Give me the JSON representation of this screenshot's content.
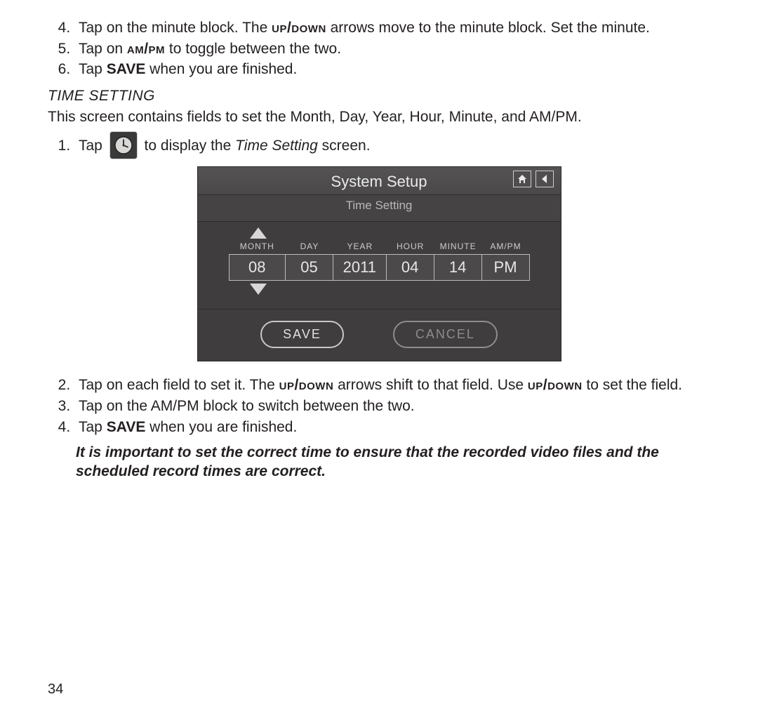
{
  "steps_a": {
    "s4a": "Tap on the minute block. The ",
    "s4b": " arrows move to the minute block. Set the minute.",
    "s5a": "Tap on ",
    "s5b": " to toggle between the two.",
    "s6a": "Tap ",
    "s6b": " when you are finished.",
    "updown": "up/down",
    "ampm": "am/pm",
    "save": "SAVE"
  },
  "section": "TIME SETTING",
  "section_para": "This screen contains fields to set the Month, Day, Year, Hour, Minute, and AM/PM.",
  "steps_b": {
    "s1a": "Tap ",
    "s1b": " to display the ",
    "s1c": " screen.",
    "time_setting_ital": "Time Setting",
    "s2a": "Tap on each field to set it. The ",
    "s2b": " arrows shift to that field. Use ",
    "s2c": " to set the field.",
    "s3": "Tap on the AM/PM block to switch between the two.",
    "s4a": "Tap ",
    "s4b": " when you are finished.",
    "updown": "up/down",
    "save": "SAVE"
  },
  "note": "It is important to set the correct time to ensure that the recorded video files and the scheduled record times are correct.",
  "shot": {
    "title": "System Setup",
    "subtitle": "Time Setting",
    "labels": {
      "month": "MONTH",
      "day": "DAY",
      "year": "YEAR",
      "hour": "HOUR",
      "minute": "MINUTE",
      "ampm": "AM/PM"
    },
    "values": {
      "month": "08",
      "day": "05",
      "year": "2011",
      "hour": "04",
      "minute": "14",
      "ampm": "PM"
    },
    "save": "SAVE",
    "cancel": "CANCEL"
  },
  "page": "34"
}
